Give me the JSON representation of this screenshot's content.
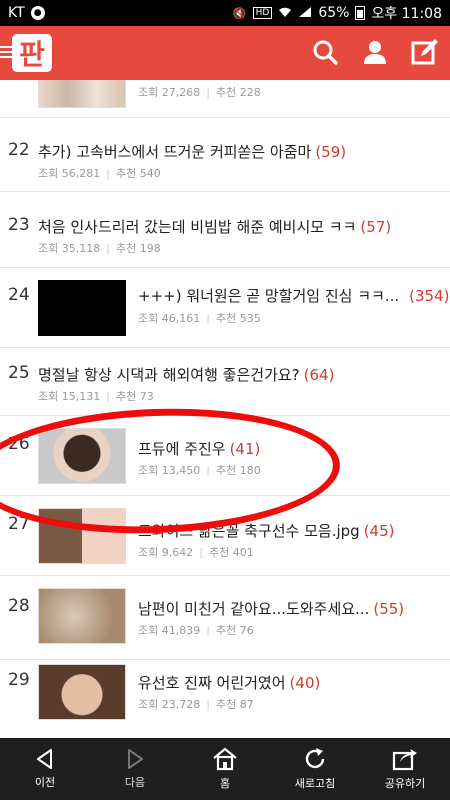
{
  "status_bar": {
    "carrier": "KT",
    "battery_percent": "65%",
    "time": "오후 11:08",
    "icons": [
      "messenger-icon",
      "mute-icon",
      "hd-icon",
      "wifi-icon",
      "signal-icon",
      "battery-icon"
    ]
  },
  "app_bar": {
    "logo_text": "판",
    "color": "#e8493f",
    "icons": [
      "menu-icon",
      "search-icon",
      "user-icon",
      "edit-icon"
    ]
  },
  "list": {
    "top_item": {
      "views_label": "조회",
      "views": "27,268",
      "likes_label": "추천",
      "likes": "228"
    },
    "items": [
      {
        "rank": "22",
        "title": "추가) 고속버스에서 뜨거운 커피쏟은 아줌마",
        "comments": "(59)",
        "views_label": "조회",
        "views": "56,281",
        "likes_label": "추천",
        "likes": "540"
      },
      {
        "rank": "23",
        "title": "처음 인사드리러 갔는데 비빔밥 해준 예비시모 ㅋㅋ",
        "comments": "(57)",
        "views_label": "조회",
        "views": "35,118",
        "likes_label": "추천",
        "likes": "198"
      },
      {
        "rank": "24",
        "title": "+++) 워너원은 곧 망할거임 진심 ㅋㅋ...",
        "comments": "(354)",
        "views_label": "조회",
        "views": "46,161",
        "likes_label": "추천",
        "likes": "535"
      },
      {
        "rank": "25",
        "title": "명절날 항상 시댁과 해외여행 좋은건가요?",
        "comments": "(64)",
        "views_label": "조회",
        "views": "15,131",
        "likes_label": "추천",
        "likes": "73"
      },
      {
        "rank": "26",
        "title": "프듀에 주진우",
        "comments": "(41)",
        "views_label": "조회",
        "views": "13,450",
        "likes_label": "추천",
        "likes": "180"
      },
      {
        "rank": "27",
        "title": "트와이스 닮은꼴 축구선수 모음.jpg",
        "comments": "(45)",
        "views_label": "조회",
        "views": "9,642",
        "likes_label": "추천",
        "likes": "401"
      },
      {
        "rank": "28",
        "title": "남편이 미친거 같아요...도와주세요...",
        "comments": "(55)",
        "views_label": "조회",
        "views": "41,839",
        "likes_label": "추천",
        "likes": "76"
      },
      {
        "rank": "29",
        "title": "유선호 진짜 어린거였어",
        "comments": "(40)",
        "views_label": "조회",
        "views": "23,728",
        "likes_label": "추천",
        "likes": "87"
      }
    ]
  },
  "bottom_nav": {
    "back": "이전",
    "forward": "다음",
    "home": "홈",
    "refresh": "새로고침",
    "share": "공유하기"
  }
}
